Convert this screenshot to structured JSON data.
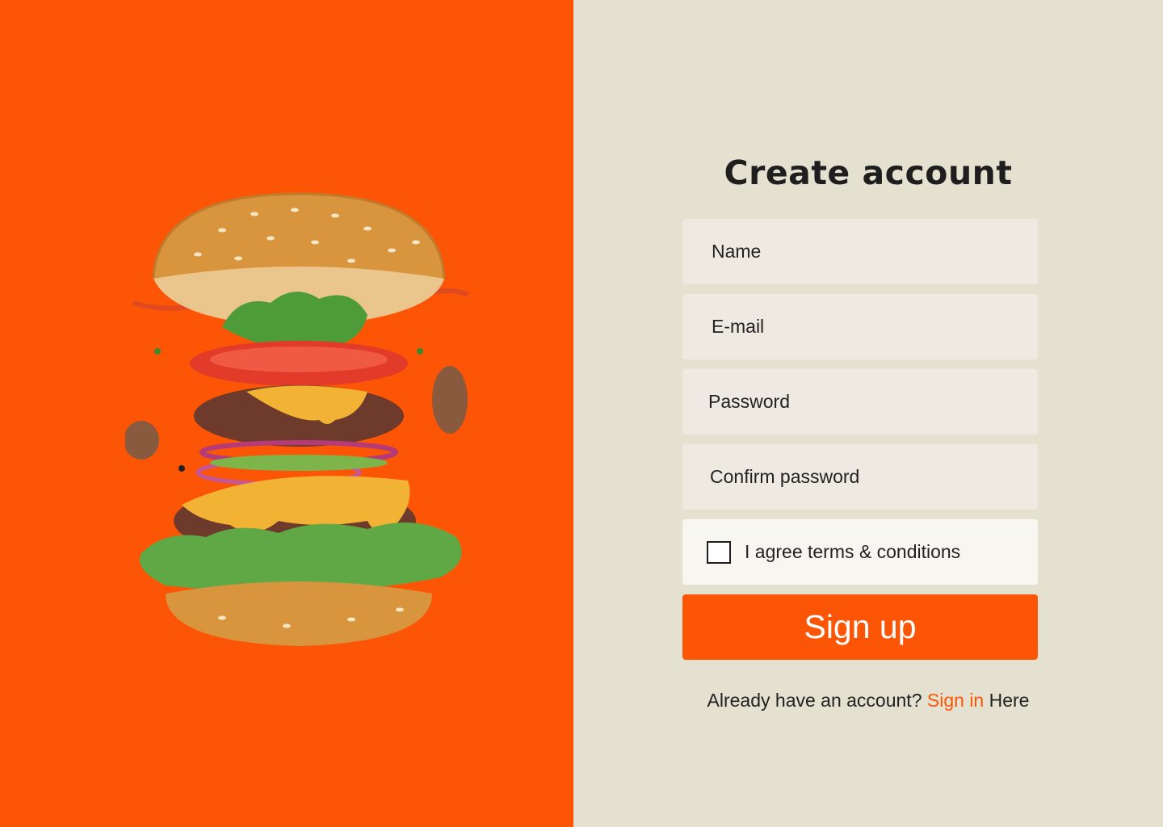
{
  "colors": {
    "accent": "#FC5505",
    "panel_bg": "#E4E1D0",
    "field_bg": "#EEEAE2",
    "checkbox_row_bg": "#F7F6F1",
    "text": "#1E1E1E"
  },
  "form": {
    "title": "Create account",
    "name_placeholder": "Name",
    "email_placeholder": "E-mail",
    "password_placeholder": "Password",
    "confirm_password_placeholder": "Confirm password",
    "agree_label": "I agree terms & conditions",
    "agree_checked": false,
    "submit_label": "Sign up"
  },
  "footer": {
    "prefix": "Already have an account?",
    "link": "Sign in",
    "suffix": "Here"
  },
  "hero": {
    "image": "burger-illustration"
  }
}
